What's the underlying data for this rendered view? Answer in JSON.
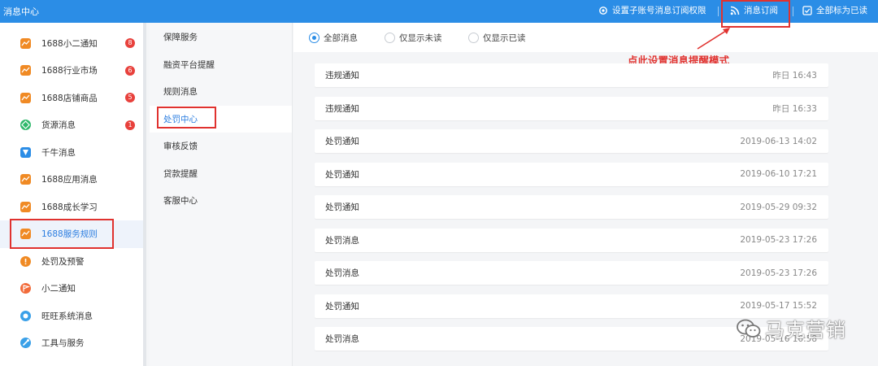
{
  "topbar": {
    "title": "消息中心",
    "sub_account_label": "设置子账号消息订阅权限",
    "subscribe_label": "消息订阅",
    "mark_all_read_label": "全部标为已读"
  },
  "sidebar": {
    "items": [
      {
        "label": "1688小二通知",
        "badge": "8",
        "icon": "chart-icon",
        "color": "#f08a24"
      },
      {
        "label": "1688行业市场",
        "badge": "6",
        "icon": "chart-icon",
        "color": "#f08a24"
      },
      {
        "label": "1688店铺商品",
        "badge": "5",
        "icon": "chart-icon",
        "color": "#f08a24"
      },
      {
        "label": "货源消息",
        "badge": "1",
        "icon": "diamond-icon",
        "color": "#2fb86b"
      },
      {
        "label": "千牛消息",
        "badge": "",
        "icon": "qianniu-icon",
        "color": "#2b8de6"
      },
      {
        "label": "1688应用消息",
        "badge": "",
        "icon": "chart-icon",
        "color": "#f08a24"
      },
      {
        "label": "1688成长学习",
        "badge": "",
        "icon": "chart-icon",
        "color": "#f08a24"
      },
      {
        "label": "1688服务规则",
        "badge": "",
        "icon": "chart-icon",
        "color": "#f08a24",
        "active": true
      },
      {
        "label": "处罚及预警",
        "badge": "",
        "icon": "warning-icon",
        "color": "#f08a24"
      },
      {
        "label": "小二通知",
        "badge": "",
        "icon": "flag-icon",
        "color": "#f26b3a"
      },
      {
        "label": "旺旺系统消息",
        "badge": "",
        "icon": "chat-icon",
        "color": "#3aa0e8"
      },
      {
        "label": "工具与服务",
        "badge": "",
        "icon": "tool-icon",
        "color": "#3aa0e8"
      }
    ]
  },
  "subnav": {
    "items": [
      {
        "label": "保障服务"
      },
      {
        "label": "融资平台提醒"
      },
      {
        "label": "规则消息"
      },
      {
        "label": "处罚中心",
        "active": true
      },
      {
        "label": "审核反馈"
      },
      {
        "label": "贷款提醒"
      },
      {
        "label": "客服中心"
      }
    ]
  },
  "filters": {
    "all": "全部消息",
    "unread": "仅显示未读",
    "read": "仅显示已读",
    "selected": "all"
  },
  "annotation": "点此设置消息提醒模式",
  "messages": [
    {
      "title": "违规通知",
      "time": "昨日 16:43"
    },
    {
      "title": "违规通知",
      "time": "昨日 16:33"
    },
    {
      "title": "处罚通知",
      "time": "2019-06-13 14:02"
    },
    {
      "title": "处罚通知",
      "time": "2019-06-10 17:21"
    },
    {
      "title": "处罚通知",
      "time": "2019-05-29 09:32"
    },
    {
      "title": "处罚消息",
      "time": "2019-05-23 17:26"
    },
    {
      "title": "处罚消息",
      "time": "2019-05-23 17:26"
    },
    {
      "title": "处罚通知",
      "time": "2019-05-17 15:52"
    },
    {
      "title": "处罚消息",
      "time": "2019-05-16 16:58"
    }
  ],
  "watermark": "马克营销",
  "colors": {
    "accent": "#2b8de6",
    "highlight": "#e0322f",
    "badge": "#e8413c"
  }
}
